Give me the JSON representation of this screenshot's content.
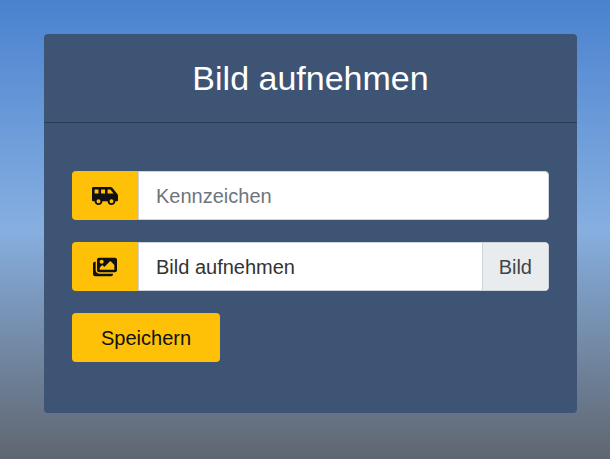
{
  "form": {
    "title": "Bild aufnehmen"
  },
  "fields": [
    {
      "kind": "text",
      "placeholder": "Kennzeichen"
    },
    {
      "kind": "file",
      "label": "Bild aufnehmen",
      "button": "Bild"
    }
  ],
  "submit": {
    "label": "Speichern"
  }
}
